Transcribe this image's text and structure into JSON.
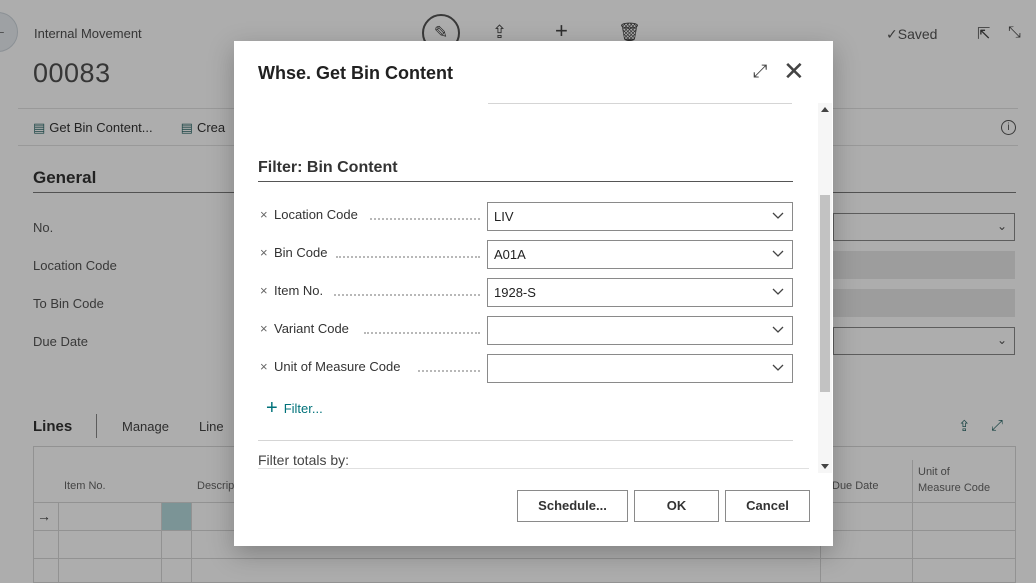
{
  "background": {
    "breadcrumb": "Internal Movement",
    "doc_no": "00083",
    "saved_label": "Saved",
    "actions": [
      "Get Bin Content...",
      "Crea"
    ],
    "general_title": "General",
    "fields": [
      "No.",
      "Location Code",
      "To Bin Code",
      "Due Date"
    ],
    "lines_title": "Lines",
    "lines_menu": [
      "Manage",
      "Line"
    ],
    "grid_headers": [
      "Item No.",
      "Descrip",
      "Due Date",
      "Unit of",
      "Measure Code"
    ],
    "row_marker": "→"
  },
  "dialog": {
    "title": "Whse. Get Bin Content",
    "section_title": "Filter: Bin Content",
    "filters": [
      {
        "label": "Location Code",
        "value": "LIV"
      },
      {
        "label": "Bin Code",
        "value": "A01A"
      },
      {
        "label": "Item No.",
        "value": "1928-S"
      },
      {
        "label": "Variant Code",
        "value": ""
      },
      {
        "label": "Unit of Measure Code",
        "value": ""
      }
    ],
    "remove_glyph": "×",
    "add_filter_label": "Filter...",
    "totals_label": "Filter totals by:",
    "buttons": {
      "schedule": "Schedule...",
      "ok": "OK",
      "cancel": "Cancel"
    }
  },
  "colors": {
    "accent": "#00727a",
    "overlay": "rgba(0,0,0,0.32)"
  }
}
